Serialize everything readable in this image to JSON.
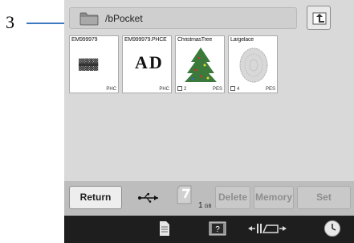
{
  "callout": {
    "number": "3"
  },
  "header": {
    "path": "/bPocket",
    "folder_icon": "folder-icon",
    "up_icon": "folder-up-icon"
  },
  "files": [
    {
      "name": "EM999979",
      "format": "PHC",
      "count": ""
    },
    {
      "name": "EM999979.PHCE",
      "format": "PHC",
      "count": ""
    },
    {
      "name": "ChristmasTree",
      "format": "PES",
      "count": "2"
    },
    {
      "name": "Largelace",
      "format": "PES",
      "count": "4"
    }
  ],
  "bottom": {
    "return_label": "Return",
    "usb_icon": "usb-icon",
    "card_icon": "memory-card-icon",
    "size_label": "1",
    "size_unit": "GB",
    "delete_label": "Delete",
    "memory_label": "Memory",
    "set_label": "Set"
  },
  "iconbar": [
    "page-icon",
    "help-icon",
    "presser-foot-icon",
    "clock-icon"
  ],
  "colors": {
    "callout_line": "#3e78c0",
    "screen_bg": "#d9d9d9",
    "bottom_bar": "#bdbdbd",
    "icon_bar": "#1e1e1e"
  }
}
